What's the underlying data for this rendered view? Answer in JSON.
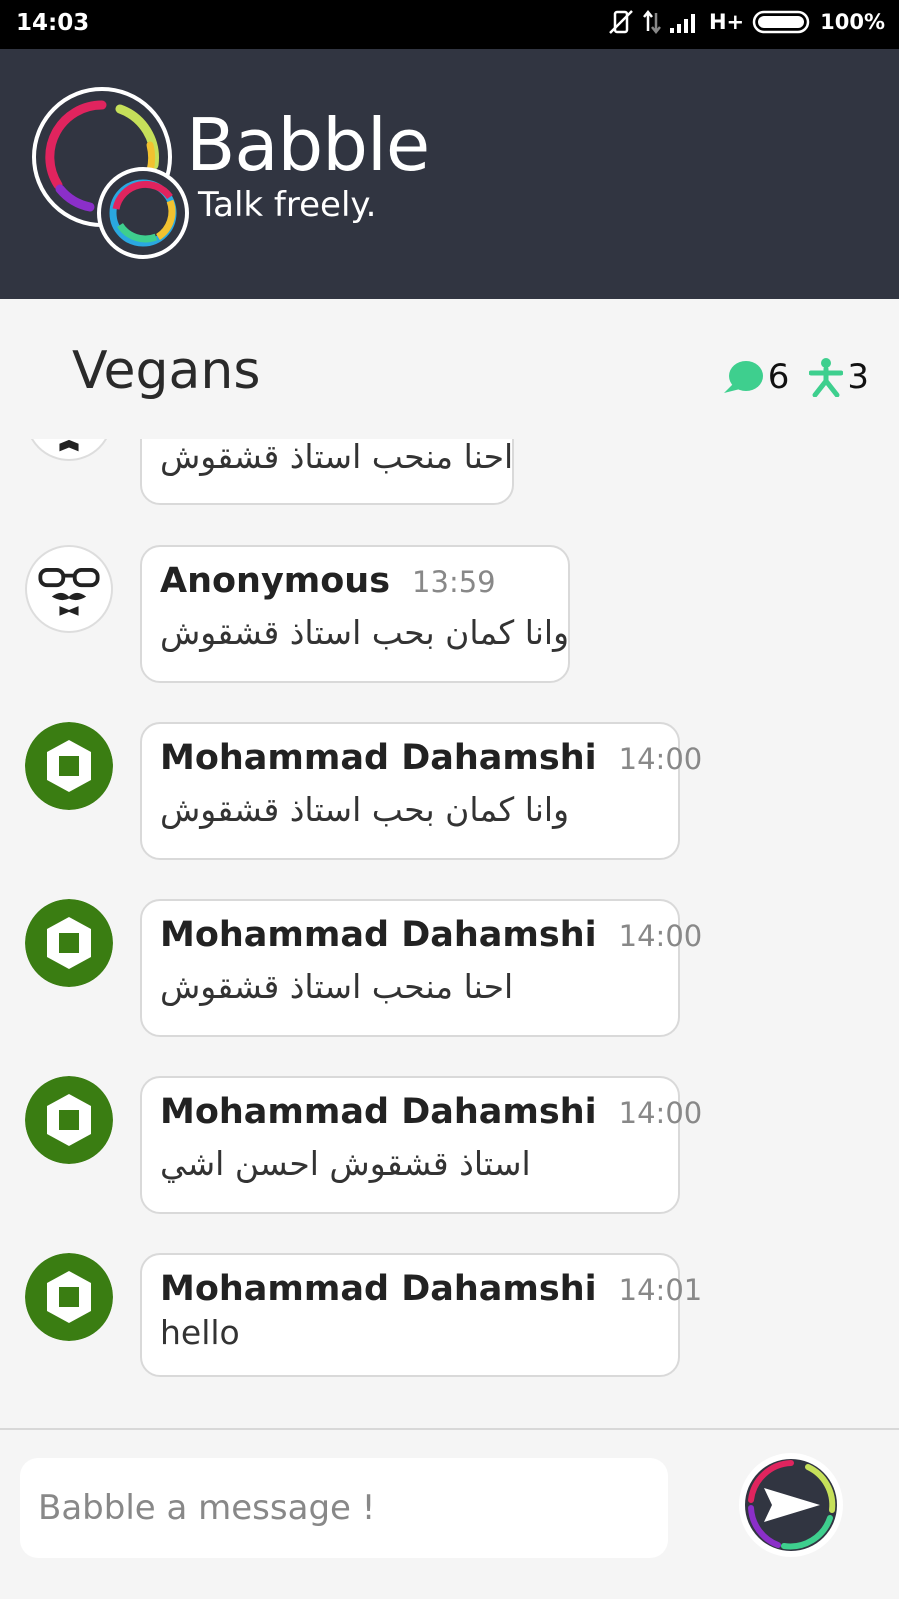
{
  "status_bar": {
    "time": "14:03",
    "network": "H+",
    "battery": "100%"
  },
  "header": {
    "title": "Babble",
    "tagline": "Talk freely."
  },
  "room": {
    "name": "Vegans",
    "message_count": "6",
    "user_count": "3"
  },
  "messages": [
    {
      "author": "",
      "time": "",
      "text": "احنا منحب استاذ قشقوش",
      "avatar": "mustache-avatar-icon"
    },
    {
      "author": "Anonymous",
      "time": "13:59",
      "text": "وانا كمان بحب استاذ قشقوش",
      "avatar": "mustache-avatar-icon"
    },
    {
      "author": "Mohammad Dahamshi",
      "time": "14:00",
      "text": "وانا كمان بحب استاذ قشقوش",
      "avatar": "identicon-avatar-icon"
    },
    {
      "author": "Mohammad Dahamshi",
      "time": "14:00",
      "text": "احنا منحب استاذ قشقوش",
      "avatar": "identicon-avatar-icon"
    },
    {
      "author": "Mohammad Dahamshi",
      "time": "14:00",
      "text": "استاذ قشقوش احسن اشي",
      "avatar": "identicon-avatar-icon"
    },
    {
      "author": "Mohammad Dahamshi",
      "time": "14:01",
      "text": "hello",
      "avatar": "identicon-avatar-icon"
    }
  ],
  "composer": {
    "placeholder": "Babble a message !"
  },
  "colors": {
    "header_bg": "#313541",
    "accent_green": "#3ecf8e",
    "avatar_green": "#3a7d12"
  }
}
